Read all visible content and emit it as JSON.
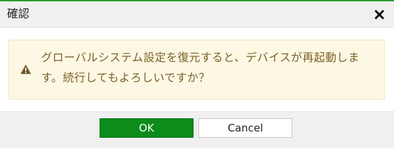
{
  "dialog": {
    "title": "確認",
    "close_icon": "close-icon",
    "message": "グローバルシステム設定を復元すると、デバイスが再起動します。続行してもよろしいですか？",
    "warning_icon": "warning-triangle-icon",
    "ok_label": "OK",
    "cancel_label": "Cancel"
  },
  "colors": {
    "accent_top_border": "#2e9a2e",
    "ok_button": "#0c8c1a",
    "alert_background": "#fdf8e3",
    "alert_text": "#7a6129"
  }
}
